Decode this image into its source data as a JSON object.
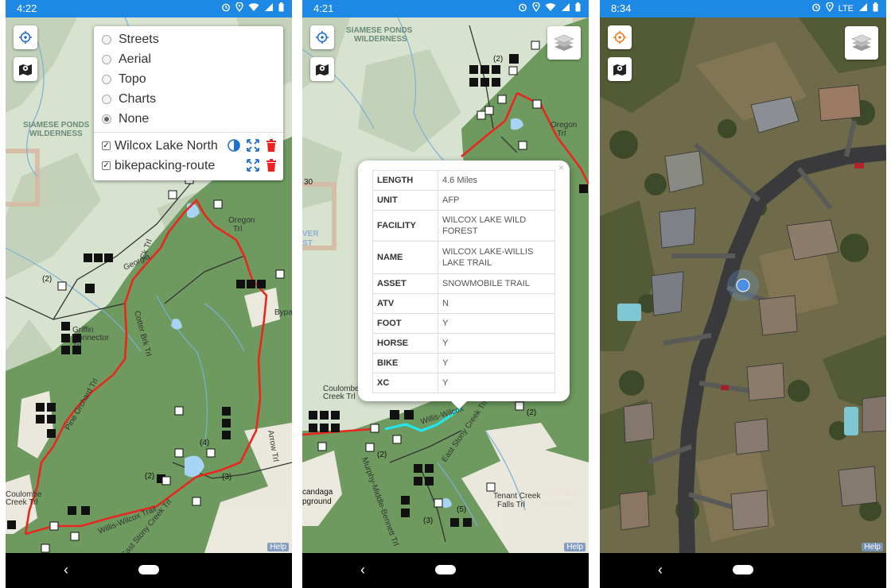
{
  "colors": {
    "status_bar": "#1e88e5",
    "forest": "#6e9a5f",
    "topo_bg": "#d7e3cf",
    "route_red": "#e8271f",
    "highlight_cyan": "#22e7f0"
  },
  "screens": [
    {
      "status": {
        "time": "4:22",
        "icons": [
          "alarm-icon",
          "location-icon",
          "wifi-icon",
          "signal-icon",
          "battery-icon"
        ]
      },
      "map_labels": {
        "wilderness": "SIAMESE PONDS\nWILDERNESS",
        "oregon": "Oregon\nTrl",
        "georgia": "Georgia\nCk Trl",
        "cotter": "Cotter Brk Trl",
        "pine_orchard": "Pine Orchard Trl",
        "arrow": "Arrow Trl",
        "willis": "Willis-Wilcox Trail",
        "east_stony": "East Stony Creek Trl",
        "griffin": "Griffin\nConnector\nTrl",
        "coulombe": "Coulombe\nCreek Trl",
        "bypass": "Bypa",
        "count_2a": "(2)",
        "count_2b": "(2)",
        "count_4": "(4)",
        "count_3": "(3)"
      },
      "help": "Help",
      "layers_panel": {
        "base_layers": [
          {
            "label": "Streets",
            "selected": false
          },
          {
            "label": "Aerial",
            "selected": false
          },
          {
            "label": "Topo",
            "selected": false
          },
          {
            "label": "Charts",
            "selected": false
          },
          {
            "label": "None",
            "selected": true
          }
        ],
        "overlays": [
          {
            "label": "Wilcox Lake North",
            "checked": true,
            "tools": [
              "opacity-icon",
              "zoom-extent-icon",
              "delete-icon"
            ]
          },
          {
            "label": "bikepacking-route",
            "checked": true,
            "tools": [
              "zoom-extent-icon",
              "delete-icon"
            ]
          }
        ]
      }
    },
    {
      "status": {
        "time": "4:21",
        "icons": [
          "alarm-icon",
          "location-icon",
          "wifi-icon",
          "signal-icon",
          "battery-icon"
        ]
      },
      "map_labels": {
        "wilderness": "SIAMESE PONDS\nWILDERNESS",
        "oregon": "Oregon\nTrl",
        "coulombe": "Coulombe\nCreek Trl",
        "willis": "Willis-Wilcox",
        "east_stony": "East Stony Creek Trl",
        "murphy": "Murphy-Middle-Bennett Trl",
        "tenant": "Tenant Creek\nFalls Trl",
        "farrell": "FARRELL\nEASEME",
        "canadaga": "candaga\npground",
        "river": "VER\nST",
        "count_2a": "(2)",
        "count_2b": "(2)",
        "count_2c": "(2)",
        "count_3": "(3)",
        "count_5": "(5)",
        "route_30": "30"
      },
      "help": "Help",
      "popup": {
        "close": "×",
        "rows": [
          {
            "key": "LENGTH",
            "value": "4.6 Miles"
          },
          {
            "key": "UNIT",
            "value": "AFP"
          },
          {
            "key": "FACILITY",
            "value": "WILCOX LAKE WILD FOREST"
          },
          {
            "key": "NAME",
            "value": "WILCOX LAKE-WILLIS LAKE TRAIL"
          },
          {
            "key": "ASSET",
            "value": "SNOWMOBILE TRAIL"
          },
          {
            "key": "ATV",
            "value": "N"
          },
          {
            "key": "FOOT",
            "value": "Y"
          },
          {
            "key": "HORSE",
            "value": "Y"
          },
          {
            "key": "BIKE",
            "value": "Y"
          },
          {
            "key": "XC",
            "value": "Y"
          }
        ]
      }
    },
    {
      "status": {
        "time": "8:34",
        "network": "LTE",
        "icons": [
          "alarm-icon",
          "location-icon",
          "signal-icon",
          "battery-icon"
        ]
      },
      "help": "Help",
      "map_type": "aerial"
    }
  ]
}
